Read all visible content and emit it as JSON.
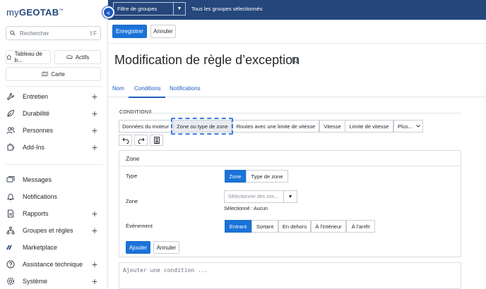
{
  "app": {
    "logo_prefix": "my",
    "logo_main": "GEOTAB",
    "logo_mark": "™"
  },
  "sidebar": {
    "search_placeholder": "Rechercher",
    "search_shortcut": "⇧F",
    "quick": {
      "dashboard": "Tableau de b...",
      "assets": "Actifs",
      "map": "Carte"
    },
    "items": [
      {
        "label": "Entretien",
        "icon": "wrench-icon",
        "has_add": true
      },
      {
        "label": "Durabilité",
        "icon": "leaf-icon",
        "has_add": true
      },
      {
        "label": "Personnes",
        "icon": "people-icon",
        "has_add": true
      },
      {
        "label": "Add-Ins",
        "icon": "puzzle-icon",
        "has_add": true
      },
      {
        "label": "Messages",
        "icon": "messages-icon",
        "has_add": false
      },
      {
        "label": "Notifications",
        "icon": "bell-icon",
        "has_add": false
      },
      {
        "label": "Rapports",
        "icon": "report-icon",
        "has_add": true
      },
      {
        "label": "Groupes et règles",
        "icon": "groups-icon",
        "has_add": true
      },
      {
        "label": "Marketplace",
        "icon": "marketplace-icon",
        "has_add": false
      },
      {
        "label": "Assistance technique",
        "icon": "help-icon",
        "has_add": true
      },
      {
        "label": "Système",
        "icon": "gear-icon",
        "has_add": true
      }
    ]
  },
  "topbar": {
    "group_filter_label": "Filtre de groupes",
    "group_status": "Tous les groupes sélectionnés"
  },
  "toolbar": {
    "save_label": "Enregistrer",
    "cancel_label": "Annuler"
  },
  "page": {
    "title": "Modification de règle d’exception"
  },
  "tabs": [
    {
      "label": "Nom",
      "active": false
    },
    {
      "label": "Conditions",
      "active": true
    },
    {
      "label": "Notifications",
      "active": false
    }
  ],
  "conditions": {
    "section_label": "CONDITIONS",
    "chips": [
      {
        "label": "Données du moteur",
        "selected": false
      },
      {
        "label": "Zone ou type de zone",
        "selected": true
      },
      {
        "label": "Routes avec une limite de vitesse",
        "selected": false
      },
      {
        "label": "Vitesse",
        "selected": false
      },
      {
        "label": "Limite de vitesse",
        "selected": false
      },
      {
        "label": "Plus...",
        "selected": false
      }
    ],
    "undo_icon": "undo-icon",
    "redo_icon": "redo-icon",
    "document_icon": "document-icon"
  },
  "zone_panel": {
    "title": "Zone",
    "type_label": "Type",
    "type_options": [
      {
        "label": "Zone",
        "selected": true
      },
      {
        "label": "Type de zone",
        "selected": false
      }
    ],
    "zone_label": "Zone",
    "zone_placeholder": "Sélectionner des zon...",
    "zone_selection": "Sélectionné : Aucun",
    "event_label": "Événement",
    "event_options": [
      {
        "label": "Entrant",
        "selected": true
      },
      {
        "label": "Sortant",
        "selected": false
      },
      {
        "label": "En dehors",
        "selected": false
      },
      {
        "label": "À l'intérieur",
        "selected": false
      },
      {
        "label": "À l'arrêt",
        "selected": false
      }
    ],
    "add_label": "Ajouter",
    "cancel_label": "Annuler"
  },
  "add_condition_placeholder": "Ajouter une condition ...",
  "colors": {
    "brand": "#25477b",
    "accent": "#1a73d9",
    "focus": "#3b7de6"
  }
}
